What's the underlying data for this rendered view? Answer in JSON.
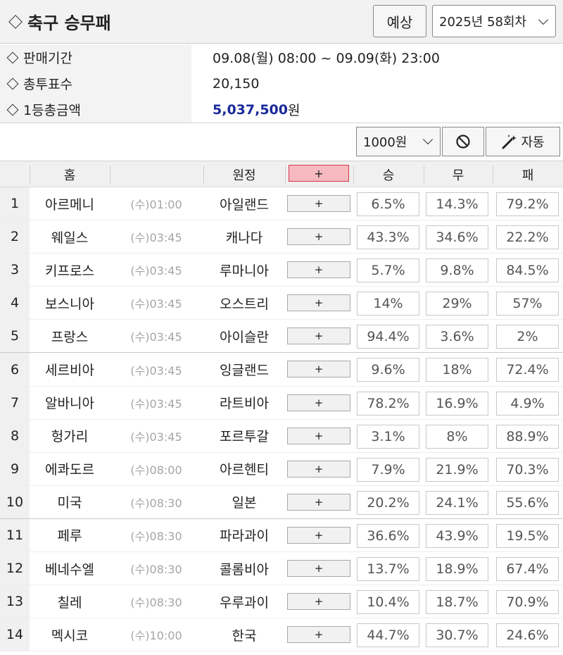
{
  "header": {
    "title": "축구 승무패",
    "predict_label": "예상",
    "round_label": "2025년 58회차"
  },
  "info": {
    "sale_period_label": "판매기간",
    "sale_period_value": "09.08(월) 08:00 ~ 09.09(화) 23:00",
    "total_votes_label": "총투표수",
    "total_votes_value": "20,150",
    "first_prize_label": "1등총금액",
    "first_prize_amount": "5,037,500",
    "first_prize_unit": "원"
  },
  "toolbar": {
    "amount_label": "1000원",
    "auto_label": "자동"
  },
  "table": {
    "headers": {
      "home": "홈",
      "away": "원정",
      "plus": "+",
      "win": "승",
      "draw": "무",
      "loss": "패"
    },
    "rows": [
      {
        "no": "1",
        "home": "아르메니",
        "time": "(수)01:00",
        "away": "아일랜드",
        "plus": "+",
        "win": "6.5%",
        "draw": "14.3%",
        "loss": "79.2%"
      },
      {
        "no": "2",
        "home": "웨일스",
        "time": "(수)03:45",
        "away": "캐나다",
        "plus": "+",
        "win": "43.3%",
        "draw": "34.6%",
        "loss": "22.2%"
      },
      {
        "no": "3",
        "home": "키프로스",
        "time": "(수)03:45",
        "away": "루마니아",
        "plus": "+",
        "win": "5.7%",
        "draw": "9.8%",
        "loss": "84.5%"
      },
      {
        "no": "4",
        "home": "보스니아",
        "time": "(수)03:45",
        "away": "오스트리",
        "plus": "+",
        "win": "14%",
        "draw": "29%",
        "loss": "57%"
      },
      {
        "no": "5",
        "home": "프랑스",
        "time": "(수)03:45",
        "away": "아이슬란",
        "plus": "+",
        "win": "94.4%",
        "draw": "3.6%",
        "loss": "2%"
      },
      {
        "no": "6",
        "home": "세르비아",
        "time": "(수)03:45",
        "away": "잉글랜드",
        "plus": "+",
        "win": "9.6%",
        "draw": "18%",
        "loss": "72.4%"
      },
      {
        "no": "7",
        "home": "알바니아",
        "time": "(수)03:45",
        "away": "라트비아",
        "plus": "+",
        "win": "78.2%",
        "draw": "16.9%",
        "loss": "4.9%"
      },
      {
        "no": "8",
        "home": "헝가리",
        "time": "(수)03:45",
        "away": "포르투갈",
        "plus": "+",
        "win": "3.1%",
        "draw": "8%",
        "loss": "88.9%"
      },
      {
        "no": "9",
        "home": "에콰도르",
        "time": "(수)08:00",
        "away": "아르헨티",
        "plus": "+",
        "win": "7.9%",
        "draw": "21.9%",
        "loss": "70.3%"
      },
      {
        "no": "10",
        "home": "미국",
        "time": "(수)08:30",
        "away": "일본",
        "plus": "+",
        "win": "20.2%",
        "draw": "24.1%",
        "loss": "55.6%"
      },
      {
        "no": "11",
        "home": "페루",
        "time": "(수)08:30",
        "away": "파라과이",
        "plus": "+",
        "win": "36.6%",
        "draw": "43.9%",
        "loss": "19.5%"
      },
      {
        "no": "12",
        "home": "베네수엘",
        "time": "(수)08:30",
        "away": "콜롬비아",
        "plus": "+",
        "win": "13.7%",
        "draw": "18.9%",
        "loss": "67.4%"
      },
      {
        "no": "13",
        "home": "칠레",
        "time": "(수)08:30",
        "away": "우루과이",
        "plus": "+",
        "win": "10.4%",
        "draw": "18.7%",
        "loss": "70.9%"
      },
      {
        "no": "14",
        "home": "멕시코",
        "time": "(수)10:00",
        "away": "한국",
        "plus": "+",
        "win": "44.7%",
        "draw": "30.7%",
        "loss": "24.6%"
      }
    ]
  }
}
